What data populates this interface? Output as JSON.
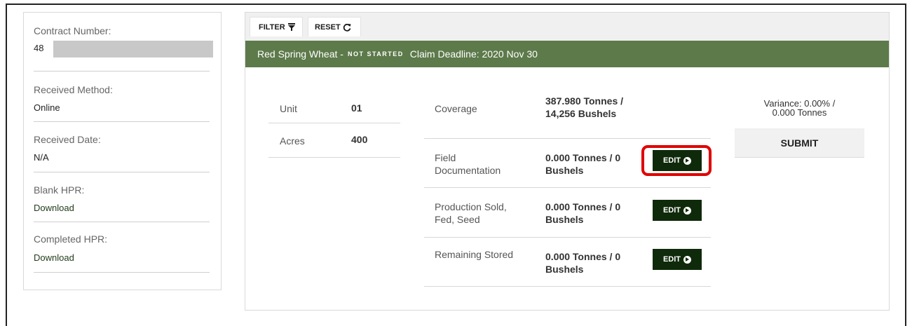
{
  "contract": {
    "number_label": "Contract Number:",
    "number_value": "48",
    "received_method_label": "Received Method:",
    "received_method_value": "Online",
    "received_date_label": "Received Date:",
    "received_date_value": "N/A",
    "blank_hpr_label": "Blank HPR:",
    "blank_hpr_link": "Download",
    "completed_hpr_label": "Completed HPR:",
    "completed_hpr_link": "Download"
  },
  "toolbar": {
    "filter_label": "FILTER",
    "reset_label": "RESET"
  },
  "crop": {
    "name": "Red Spring Wheat -",
    "status": "NOT STARTED",
    "deadline": "Claim Deadline: 2020 Nov 30"
  },
  "unit": {
    "unit_label": "Unit",
    "unit_value": "01",
    "acres_label": "Acres",
    "acres_value": "400"
  },
  "rows": [
    {
      "label_line1": "Coverage",
      "label_line2": "",
      "value_line1": "387.980 Tonnes /",
      "value_line2": "14,256 Bushels"
    },
    {
      "label_line1": "Field",
      "label_line2": "Documentation",
      "value_line1": "0.000 Tonnes / 0",
      "value_line2": "Bushels",
      "button": "EDIT"
    },
    {
      "label_line1": "Production Sold,",
      "label_line2": "Fed, Seed",
      "value_line1": "0.000 Tonnes / 0",
      "value_line2": "Bushels",
      "button": "EDIT"
    },
    {
      "label_line1": "Remaining Stored",
      "label_line2": "",
      "value_line1": "0.000 Tonnes / 0",
      "value_line2": "Bushels",
      "button": "EDIT"
    }
  ],
  "variance": {
    "line1": "Variance: 0.00% /",
    "line2": "0.000 Tonnes"
  },
  "submit_label": "SUBMIT",
  "colors": {
    "crop_bar": "#5d7a4a",
    "edit_button": "#0f2a0a",
    "highlight": "#e00000"
  }
}
